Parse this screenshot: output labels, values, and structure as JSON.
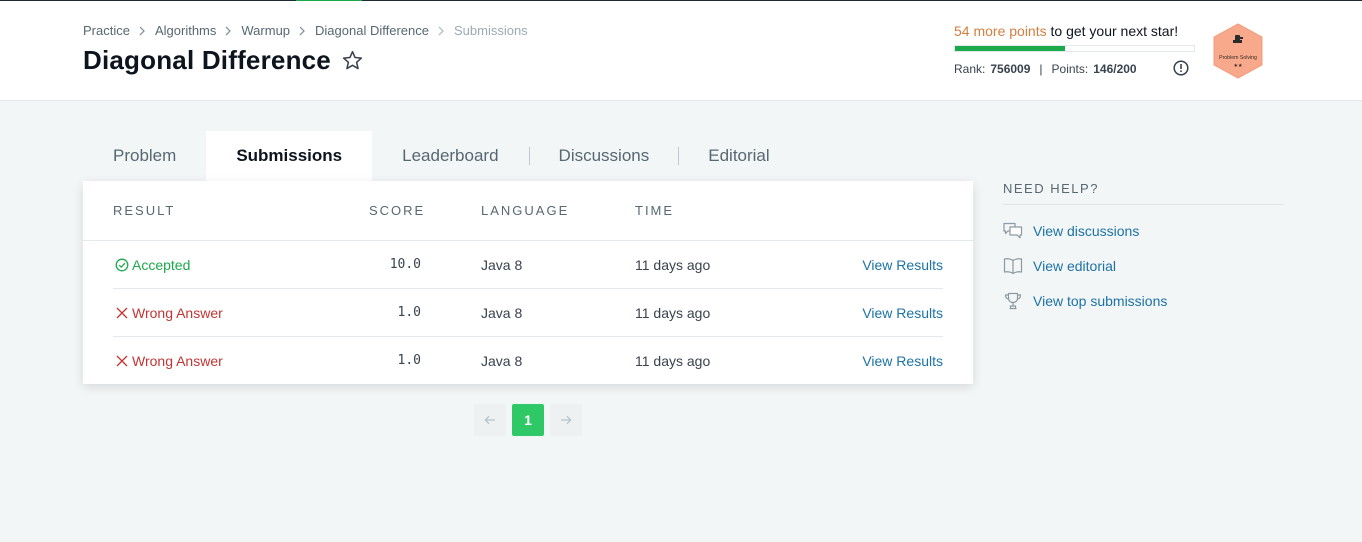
{
  "breadcrumb": {
    "items": [
      "Practice",
      "Algorithms",
      "Warmup",
      "Diagonal Difference"
    ],
    "current": "Submissions"
  },
  "page_title": "Diagonal Difference",
  "progress": {
    "points_highlight": "54 more points",
    "points_rest": " to get your next star!",
    "fill_fraction": 0.46,
    "rank_label": "Rank:",
    "rank_value": "756009",
    "points_label": "Points:",
    "points_value": "146/200"
  },
  "badge": {
    "label": "Problem Solving",
    "stars": "★★",
    "color": "#f8a98b"
  },
  "tabs": [
    {
      "label": "Problem",
      "active": false
    },
    {
      "label": "Submissions",
      "active": true
    },
    {
      "label": "Leaderboard",
      "active": false
    },
    {
      "label": "Discussions",
      "active": false
    },
    {
      "label": "Editorial",
      "active": false
    }
  ],
  "table": {
    "headers": {
      "result": "RESULT",
      "score": "SCORE",
      "language": "LANGUAGE",
      "time": "TIME"
    },
    "rows": [
      {
        "status": "Accepted",
        "status_type": "accepted",
        "score": "10.0",
        "language": "Java 8",
        "time": "11 days ago",
        "action": "View Results"
      },
      {
        "status": "Wrong Answer",
        "status_type": "wrong",
        "score": "1.0",
        "language": "Java 8",
        "time": "11 days ago",
        "action": "View Results"
      },
      {
        "status": "Wrong Answer",
        "status_type": "wrong",
        "score": "1.0",
        "language": "Java 8",
        "time": "11 days ago",
        "action": "View Results"
      }
    ]
  },
  "pagination": {
    "current_page": "1"
  },
  "help": {
    "title": "NEED HELP?",
    "items": [
      {
        "label": "View discussions",
        "icon": "discussions-icon"
      },
      {
        "label": "View editorial",
        "icon": "editorial-book-icon"
      },
      {
        "label": "View top submissions",
        "icon": "trophy-icon"
      }
    ]
  },
  "colors": {
    "accent_green": "#1ba94c",
    "wrong_red": "#c23535",
    "link_blue": "#1c72a6",
    "points_orange": "#d17f3f"
  }
}
